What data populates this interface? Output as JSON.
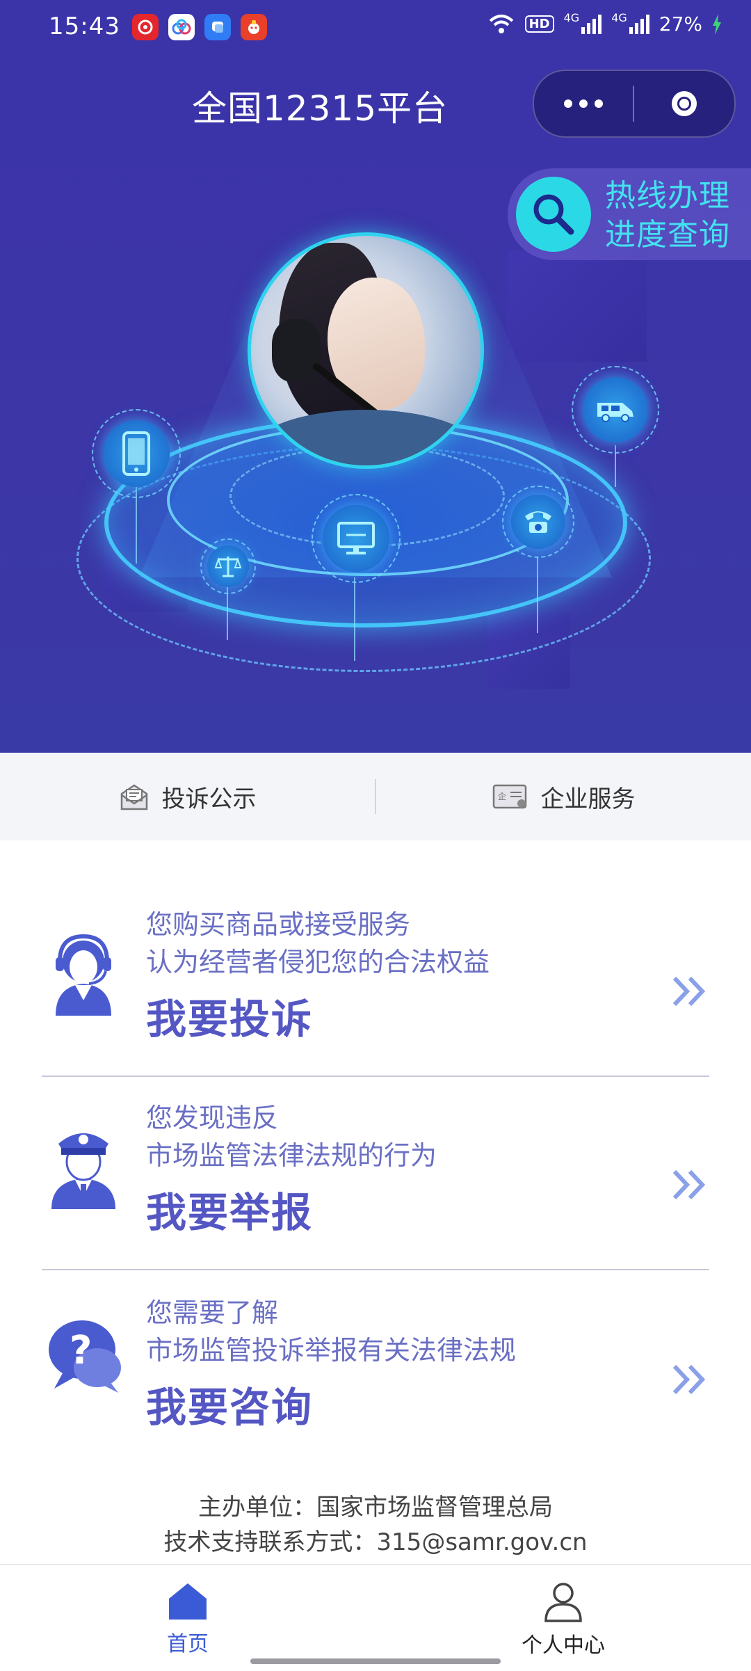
{
  "status_bar": {
    "time": "15:43",
    "network_hd": "HD",
    "network_1": "4G",
    "network_2": "4G",
    "battery": "27%",
    "app_icons": [
      "netease-music-icon",
      "baidu-netdisk-icon",
      "message-app-icon",
      "taobao-icon"
    ]
  },
  "header": {
    "title": "全国12315平台",
    "more_icon": "more-dots-icon",
    "close_icon": "close-target-icon"
  },
  "hero": {
    "hotline_line1": "热线办理",
    "hotline_line2": "进度查询",
    "nodes": [
      "mobile-phone-icon",
      "scales-icon",
      "computer-icon",
      "telephone-icon",
      "van-icon"
    ]
  },
  "quick_links": [
    {
      "label": "投诉公示",
      "icon": "complaint-notice-icon"
    },
    {
      "label": "企业服务",
      "icon": "enterprise-service-icon"
    }
  ],
  "cards": [
    {
      "line1": "您购买商品或接受服务",
      "line2": "认为经营者侵犯您的合法权益",
      "title": "我要投诉",
      "icon": "customer-service-agent-icon"
    },
    {
      "line1": "您发现违反",
      "line2": "市场监管法律法规的行为",
      "title": "我要举报",
      "icon": "officer-icon"
    },
    {
      "line1": "您需要了解",
      "line2": "市场监管投诉举报有关法律法规",
      "title": "我要咨询",
      "icon": "question-bubble-icon"
    }
  ],
  "footer": {
    "line1": "主办单位：国家市场监督管理总局",
    "line2": "技术支持联系方式：315@samr.gov.cn"
  },
  "tabbar": [
    {
      "label": "首页",
      "icon": "home-icon",
      "active": true
    },
    {
      "label": "个人中心",
      "icon": "person-icon",
      "active": false
    }
  ],
  "colors": {
    "hero_bg": "#3b33a8",
    "accent_cyan": "#44e2f0",
    "card_title": "#5457c3",
    "card_text": "#6a6fc4",
    "tab_active": "#3b5bd6"
  }
}
